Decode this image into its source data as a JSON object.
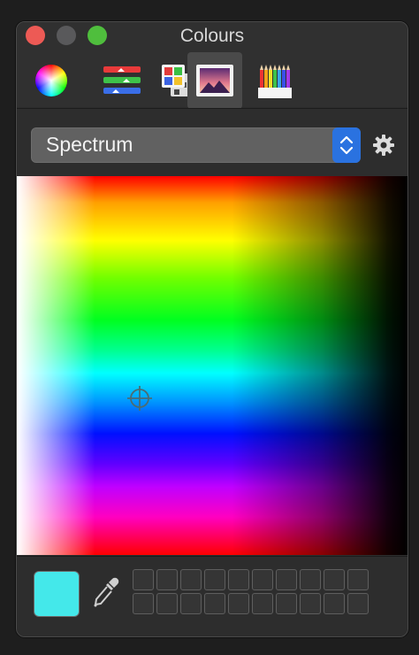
{
  "window": {
    "title": "Colours",
    "controls": [
      "close",
      "minimize",
      "maximize"
    ]
  },
  "toolbar": {
    "tools": [
      {
        "name": "colour-wheel",
        "icon": "color-wheel-icon",
        "active": false
      },
      {
        "name": "colour-sliders",
        "icon": "sliders-icon",
        "active": false
      },
      {
        "name": "colour-palettes",
        "icon": "palettes-icon",
        "active": false
      },
      {
        "name": "image-palettes",
        "icon": "image-palette-icon",
        "active": true
      },
      {
        "name": "pencils",
        "icon": "pencils-icon",
        "active": false
      }
    ]
  },
  "picker": {
    "mode_label": "Spectrum",
    "dropdown_icon": "up-down-chevron-icon",
    "settings_icon": "gear-icon"
  },
  "spectrum": {
    "cursor_icon": "crosshair-icon"
  },
  "current_colour": {
    "hex": "#44e8ea"
  },
  "eyedropper": {
    "icon": "eyedropper-icon"
  },
  "swatch_wells": {
    "rows": 2,
    "columns": 10,
    "filled": 0
  },
  "colors": {
    "accent": "#2a72e0",
    "close": "#ed5a55",
    "minimize": "#59595b",
    "maximize": "#4fbe3d",
    "background": "#2d2d2d"
  }
}
